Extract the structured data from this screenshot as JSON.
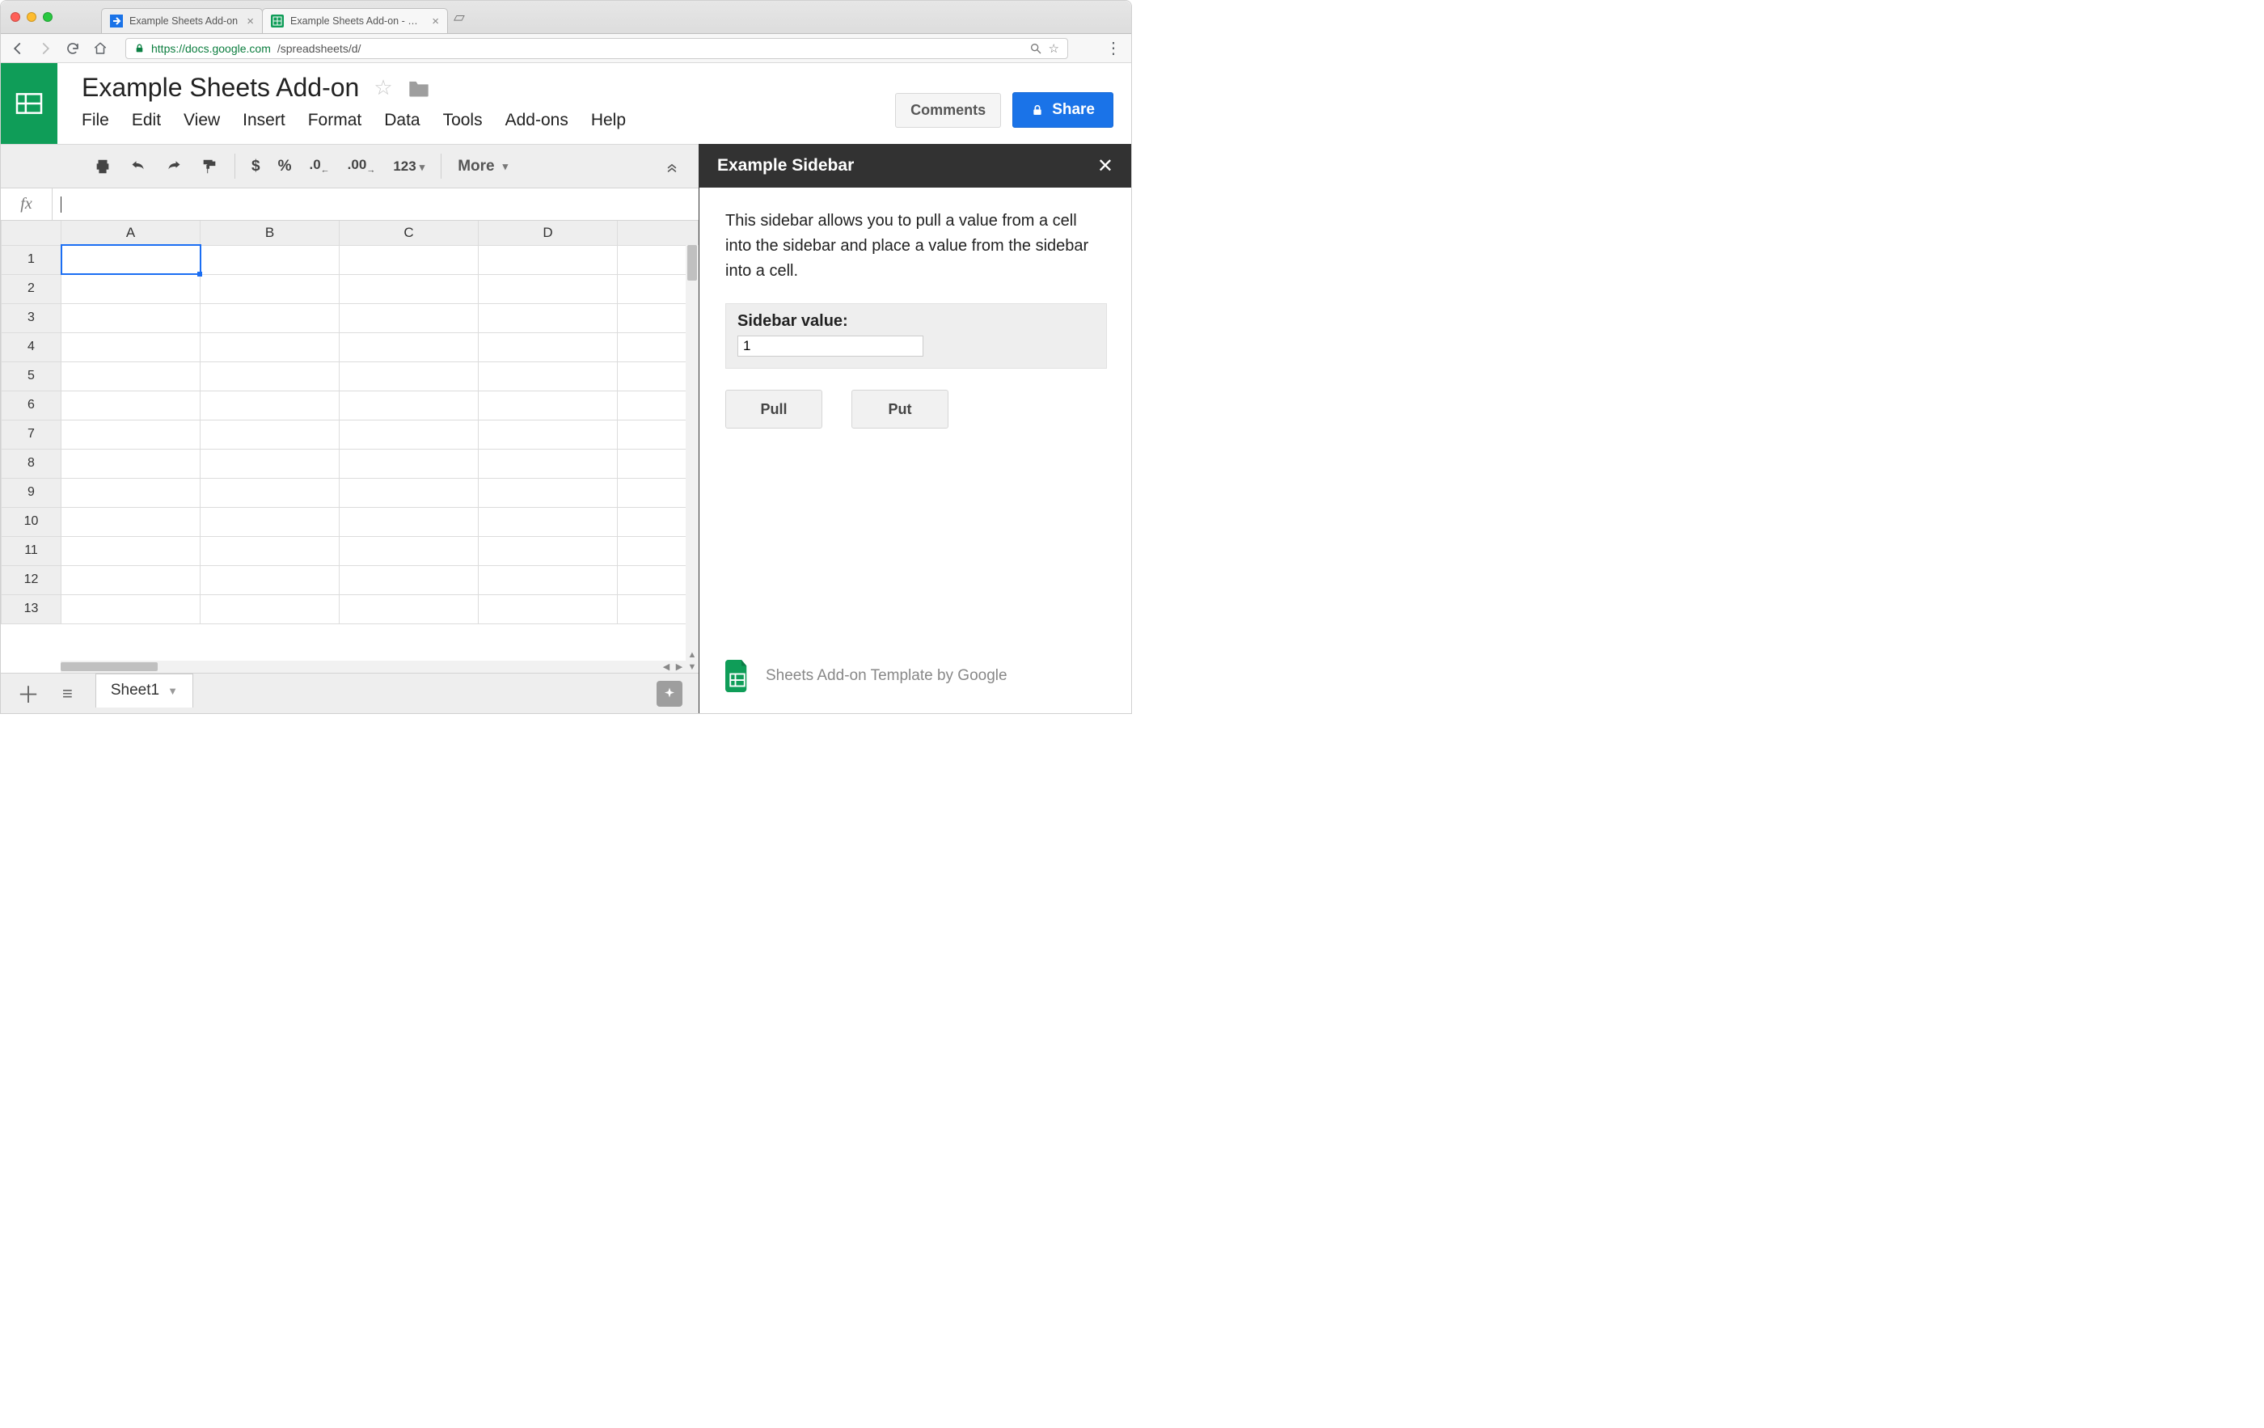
{
  "browser": {
    "tabs": [
      {
        "label": "Example Sheets Add-on",
        "active": false
      },
      {
        "label": "Example Sheets Add-on - Goo",
        "active": true
      }
    ],
    "url_host": "https://docs.google.com",
    "url_path": "/spreadsheets/d/"
  },
  "doc": {
    "title": "Example Sheets Add-on",
    "menus": [
      "File",
      "Edit",
      "View",
      "Insert",
      "Format",
      "Data",
      "Tools",
      "Add-ons",
      "Help"
    ],
    "comments_label": "Comments",
    "share_label": "Share"
  },
  "toolbar": {
    "currency": "$",
    "percent": "%",
    "dec_less": ".0",
    "dec_more": ".00",
    "num_fmt": "123",
    "more_label": "More"
  },
  "formula": {
    "value": ""
  },
  "grid": {
    "columns": [
      "A",
      "B",
      "C",
      "D",
      ""
    ],
    "rows": [
      1,
      2,
      3,
      4,
      5,
      6,
      7,
      8,
      9,
      10,
      11,
      12,
      13
    ],
    "selected": "A1"
  },
  "sidebar": {
    "title": "Example Sidebar",
    "description": "This sidebar allows you to pull a value from a cell into the sidebar and place a value from the sidebar into a cell.",
    "value_label": "Sidebar value:",
    "value": "1",
    "pull_label": "Pull",
    "put_label": "Put",
    "footer_text": "Sheets Add-on Template by Google"
  },
  "sheet_tabs": {
    "active": "Sheet1"
  }
}
